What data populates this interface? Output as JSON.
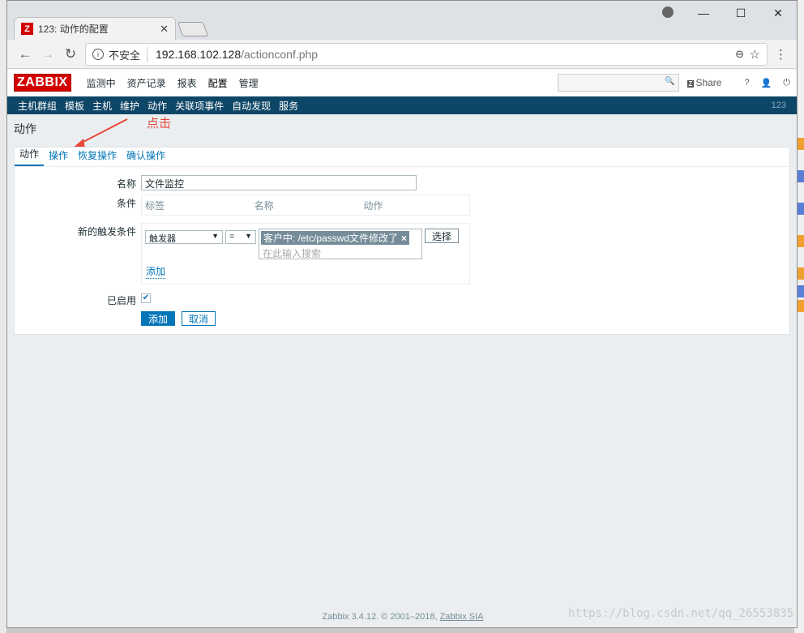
{
  "browser": {
    "tab_title": "123: 动作的配置",
    "favicon_letter": "Z",
    "security_label": "不安全",
    "url_host": "192.168.102.128",
    "url_path": "/actionconf.php"
  },
  "zabbix": {
    "logo": "ZABBIX",
    "top_nav": [
      "监测中",
      "资产记录",
      "报表",
      "配置",
      "管理"
    ],
    "share_label": "Share",
    "sub_nav": [
      "主机群组",
      "模板",
      "主机",
      "维护",
      "动作",
      "关联项事件",
      "自动发现",
      "服务"
    ],
    "user_id": "123"
  },
  "page": {
    "title": "动作",
    "annotation": "点击",
    "tabs": [
      "动作",
      "操作",
      "恢复操作",
      "确认操作"
    ],
    "form": {
      "name_label": "名称",
      "name_value": "文件监控",
      "conditions_label": "条件",
      "cond_headers": [
        "标签",
        "名称",
        "动作"
      ],
      "new_cond_label": "新的触发条件",
      "cond_type": "触发器",
      "operator": "=",
      "selected_trigger": "客户中: /etc/passwd文件修改了",
      "search_placeholder": "在此输入搜索",
      "choose_button": "选择",
      "add_link": "添加",
      "enabled_label": "已启用",
      "add_button": "添加",
      "cancel_button": "取消"
    }
  },
  "footer": {
    "text": "Zabbix 3.4.12. © 2001–2018, ",
    "link": "Zabbix SIA"
  },
  "watermark": "https://blog.csdn.net/qq_26553835"
}
